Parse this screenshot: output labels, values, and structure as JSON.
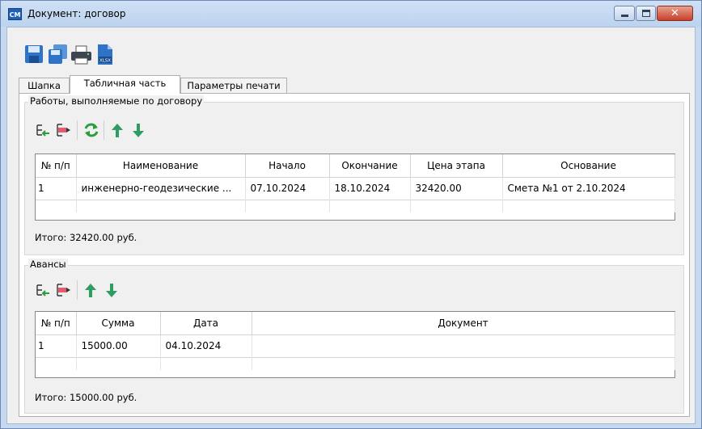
{
  "window": {
    "title": "Документ: договор",
    "app_icon_text": "CM"
  },
  "toolbar": {
    "buttons": [
      {
        "icon": "save-icon",
        "name": "save"
      },
      {
        "icon": "copy-icon",
        "name": "copy"
      },
      {
        "icon": "print-icon",
        "name": "print"
      },
      {
        "icon": "xlsx-icon",
        "name": "export-xlsx",
        "label": "XLSX"
      }
    ]
  },
  "tabs": [
    {
      "label": "Шапка",
      "active": false
    },
    {
      "label": "Табличная часть",
      "active": true
    },
    {
      "label": "Параметры печати",
      "active": false
    }
  ],
  "works": {
    "title": "Работы, выполняемые по договору",
    "columns": [
      "№ п/п",
      "Наименование",
      "Начало",
      "Окончание",
      "Цена этапа",
      "Основание"
    ],
    "rows": [
      [
        "1",
        "инженерно-геодезические ...",
        "07.10.2024",
        "18.10.2024",
        "32420.00",
        "Смета №1 от 2.10.2024"
      ]
    ],
    "total": "Итого:  32420.00 руб."
  },
  "advances": {
    "title": "Авансы",
    "columns": [
      "№ п/п",
      "Сумма",
      "Дата",
      "Документ"
    ],
    "rows": [
      [
        "1",
        "15000.00",
        "04.10.2024",
        ""
      ]
    ],
    "total": "Итого:  15000.00 руб."
  }
}
